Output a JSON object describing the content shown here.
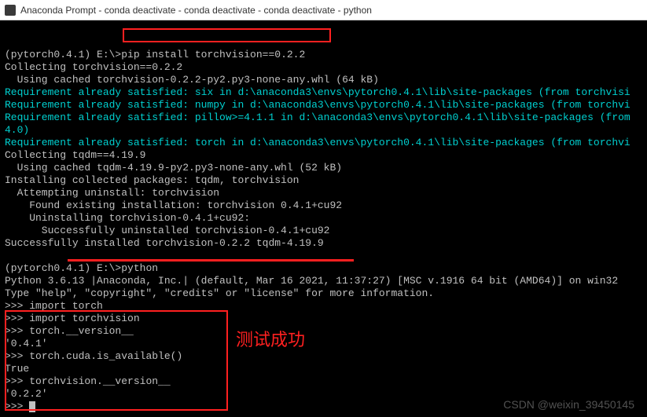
{
  "window": {
    "title": "Anaconda Prompt - conda  deactivate - conda  deactivate - conda  deactivate - python"
  },
  "term": {
    "prompt1": "(pytorch0.4.1) E:\\>",
    "cmd1": "pip install torchvision==0.2.2",
    "l1": "Collecting torchvision==0.2.2",
    "l2": "  Using cached torchvision-0.2.2-py2.py3-none-any.whl (64 kB)",
    "l3": "Requirement already satisfied: six in d:\\anaconda3\\envs\\pytorch0.4.1\\lib\\site-packages (from torchvisi",
    "l4": "Requirement already satisfied: numpy in d:\\anaconda3\\envs\\pytorch0.4.1\\lib\\site-packages (from torchvi",
    "l5": "Requirement already satisfied: pillow>=4.1.1 in d:\\anaconda3\\envs\\pytorch0.4.1\\lib\\site-packages (from",
    "l6": "4.0)",
    "l7": "Requirement already satisfied: torch in d:\\anaconda3\\envs\\pytorch0.4.1\\lib\\site-packages (from torchvi",
    "l8": "Collecting tqdm==4.19.9",
    "l9": "  Using cached tqdm-4.19.9-py2.py3-none-any.whl (52 kB)",
    "l10": "Installing collected packages: tqdm, torchvision",
    "l11": "  Attempting uninstall: torchvision",
    "l12": "    Found existing installation: torchvision 0.4.1+cu92",
    "l13": "    Uninstalling torchvision-0.4.1+cu92:",
    "l14": "      Successfully uninstalled torchvision-0.4.1+cu92",
    "l15": "Successfully installed torchvision-0.2.2 tqdm-4.19.9",
    "prompt2": "(pytorch0.4.1) E:\\>",
    "cmd2": "python",
    "py1": "Python 3.6.13 |Anaconda, Inc.| (default, Mar 16 2021, 11:37:27) [MSC v.1916 64 bit (AMD64)] on win32",
    "py2": "Type \"help\", \"copyright\", \"credits\" or \"license\" for more information.",
    "r1p": ">>> ",
    "r1": "import torch",
    "r2p": ">>> ",
    "r2": "import torchvision",
    "r3p": ">>> ",
    "r3": "torch.__version__",
    "o3": "'0.4.1'",
    "r4p": ">>> ",
    "r4": "torch.cuda.is_available()",
    "o4": "True",
    "r5p": ">>> ",
    "r5": "torchvision.__version__",
    "o5": "'0.2.2'",
    "r6p": ">>> "
  },
  "annotation": "测试成功",
  "watermark": "CSDN @weixin_39450145"
}
